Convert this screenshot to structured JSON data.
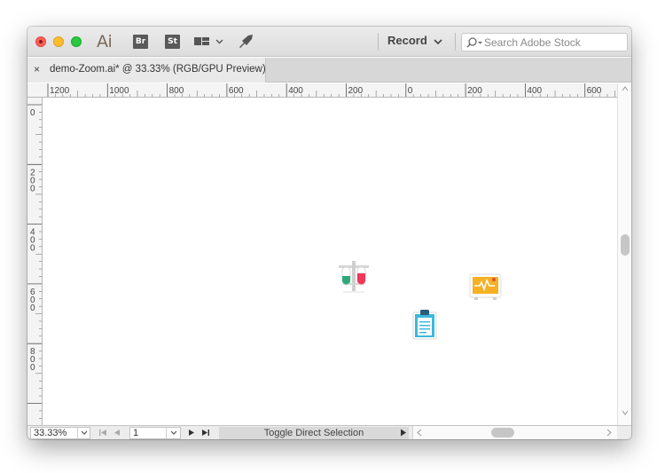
{
  "app": {
    "logo_text": "Ai",
    "bridge_label": "Br",
    "stock_label": "St",
    "record_label": "Record",
    "search_placeholder": "Search Adobe Stock",
    "search_value": ""
  },
  "document": {
    "tab_title": "demo-Zoom.ai* @ 33.33% (RGB/GPU Preview)",
    "close_label": "×"
  },
  "rulers": {
    "horizontal_labels": [
      "1200",
      "1000",
      "800",
      "600",
      "400",
      "200",
      "0",
      "200",
      "400",
      "600"
    ],
    "vertical_labels": [
      "0",
      "200",
      "400",
      "600",
      "800"
    ]
  },
  "canvas": {
    "artwork": [
      {
        "name": "test-tubes-icon",
        "colors": [
          "#2eaa7a",
          "#f0385a",
          "#cfcfcf"
        ]
      },
      {
        "name": "monitor-icon",
        "colors": [
          "#f6b024",
          "#ffffff",
          "#e84a3b"
        ]
      },
      {
        "name": "clipboard-icon",
        "colors": [
          "#3bb8dc",
          "#2a5d7a",
          "#ffffff"
        ]
      }
    ]
  },
  "statusbar": {
    "zoom_value": "33.33%",
    "page_value": "1",
    "status_text": "Toggle Direct Selection"
  },
  "colors": {
    "appbar": "#dcdcdc",
    "close": "#fc5f57",
    "minimize": "#fdbc2e",
    "maximize": "#28c840"
  }
}
